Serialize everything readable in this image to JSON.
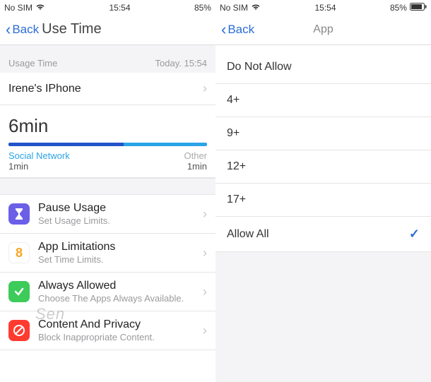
{
  "left": {
    "status": {
      "carrier": "No SIM",
      "time": "15:54",
      "battery": "85%"
    },
    "nav": {
      "back": "Back",
      "title": "Use Time"
    },
    "usage_header": {
      "label": "Usage Time",
      "stamp": "Today. 15:54"
    },
    "device_row": {
      "name": "Irene's IPhone"
    },
    "usage": {
      "total": "6min",
      "seg1_label": "Social Network",
      "seg1_val": "1min",
      "seg2_label": "Other",
      "seg2_val": "1min"
    },
    "menu": [
      {
        "title": "Pause Usage",
        "sub": "Set Usage Limits."
      },
      {
        "title": "App Limitations",
        "sub": "Set Time Limits."
      },
      {
        "title": "Always Allowed",
        "sub": "Choose The Apps Always Available."
      },
      {
        "title": "Content And Privacy",
        "sub": "Block Inappropriate Content."
      }
    ],
    "watermark": "Sen",
    "hourglass_digit": "8"
  },
  "right": {
    "status": {
      "carrier": "No SIM",
      "time": "15:54",
      "battery": "85%"
    },
    "nav": {
      "back": "Back",
      "title": "App"
    },
    "options": [
      {
        "label": "Do Not Allow",
        "checked": false
      },
      {
        "label": "4+",
        "checked": false
      },
      {
        "label": "9+",
        "checked": false
      },
      {
        "label": "12+",
        "checked": false
      },
      {
        "label": "17+",
        "checked": false
      },
      {
        "label": "Allow All",
        "checked": true
      }
    ]
  }
}
